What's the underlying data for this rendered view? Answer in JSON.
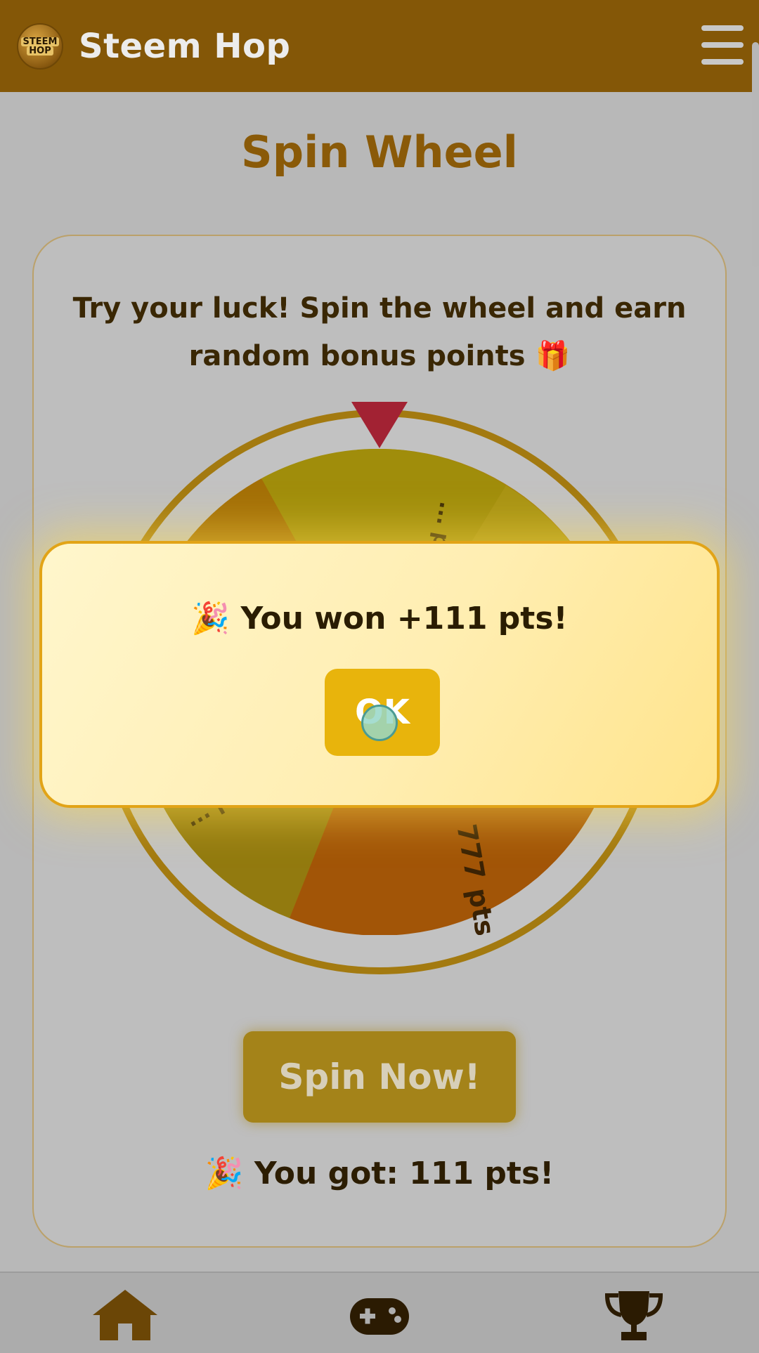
{
  "header": {
    "logo_text": [
      "STEEM",
      "HOP"
    ],
    "title": "Steem Hop",
    "menu_icon": "hamburger-menu-icon"
  },
  "main": {
    "title": "Spin Wheel",
    "intro_line1": "Try your luck! Spin the wheel and earn",
    "intro_line2": "random bonus points",
    "intro_emoji": "🎁",
    "wheel_labels": [
      "... pts",
      "777 pts",
      "... pts"
    ],
    "spin_button": "Spin Now!",
    "result_emoji": "🎉",
    "result_text": "You got: 111 pts!"
  },
  "modal": {
    "emoji": "🎉",
    "message": "You won +111 pts!",
    "ok_label": "OK"
  },
  "bottom_nav": {
    "items": [
      {
        "icon": "home-icon"
      },
      {
        "icon": "gamepad-icon"
      },
      {
        "icon": "trophy-icon"
      }
    ]
  },
  "colors": {
    "header_bg": "#845707",
    "accent_gold": "#e8b40c",
    "pointer_red": "#a22233",
    "title_brown": "#8a5a08"
  }
}
